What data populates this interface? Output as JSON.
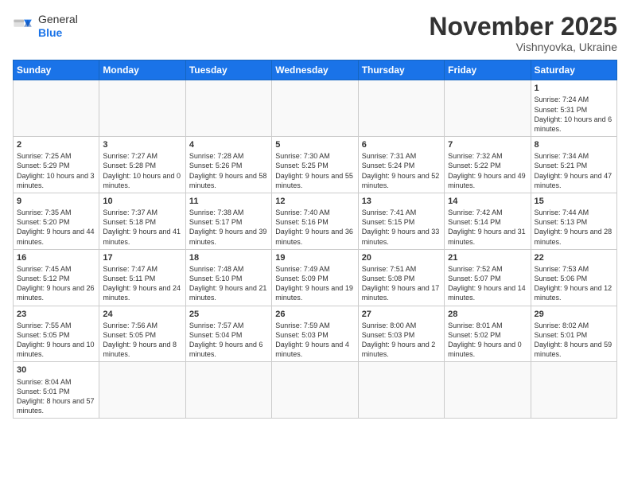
{
  "header": {
    "logo_general": "General",
    "logo_blue": "Blue",
    "month_title": "November 2025",
    "location": "Vishnyovka, Ukraine"
  },
  "weekdays": [
    "Sunday",
    "Monday",
    "Tuesday",
    "Wednesday",
    "Thursday",
    "Friday",
    "Saturday"
  ],
  "weeks": [
    [
      {
        "day": "",
        "info": ""
      },
      {
        "day": "",
        "info": ""
      },
      {
        "day": "",
        "info": ""
      },
      {
        "day": "",
        "info": ""
      },
      {
        "day": "",
        "info": ""
      },
      {
        "day": "",
        "info": ""
      },
      {
        "day": "1",
        "info": "Sunrise: 7:24 AM\nSunset: 5:31 PM\nDaylight: 10 hours and 6 minutes."
      }
    ],
    [
      {
        "day": "2",
        "info": "Sunrise: 7:25 AM\nSunset: 5:29 PM\nDaylight: 10 hours and 3 minutes."
      },
      {
        "day": "3",
        "info": "Sunrise: 7:27 AM\nSunset: 5:28 PM\nDaylight: 10 hours and 0 minutes."
      },
      {
        "day": "4",
        "info": "Sunrise: 7:28 AM\nSunset: 5:26 PM\nDaylight: 9 hours and 58 minutes."
      },
      {
        "day": "5",
        "info": "Sunrise: 7:30 AM\nSunset: 5:25 PM\nDaylight: 9 hours and 55 minutes."
      },
      {
        "day": "6",
        "info": "Sunrise: 7:31 AM\nSunset: 5:24 PM\nDaylight: 9 hours and 52 minutes."
      },
      {
        "day": "7",
        "info": "Sunrise: 7:32 AM\nSunset: 5:22 PM\nDaylight: 9 hours and 49 minutes."
      },
      {
        "day": "8",
        "info": "Sunrise: 7:34 AM\nSunset: 5:21 PM\nDaylight: 9 hours and 47 minutes."
      }
    ],
    [
      {
        "day": "9",
        "info": "Sunrise: 7:35 AM\nSunset: 5:20 PM\nDaylight: 9 hours and 44 minutes."
      },
      {
        "day": "10",
        "info": "Sunrise: 7:37 AM\nSunset: 5:18 PM\nDaylight: 9 hours and 41 minutes."
      },
      {
        "day": "11",
        "info": "Sunrise: 7:38 AM\nSunset: 5:17 PM\nDaylight: 9 hours and 39 minutes."
      },
      {
        "day": "12",
        "info": "Sunrise: 7:40 AM\nSunset: 5:16 PM\nDaylight: 9 hours and 36 minutes."
      },
      {
        "day": "13",
        "info": "Sunrise: 7:41 AM\nSunset: 5:15 PM\nDaylight: 9 hours and 33 minutes."
      },
      {
        "day": "14",
        "info": "Sunrise: 7:42 AM\nSunset: 5:14 PM\nDaylight: 9 hours and 31 minutes."
      },
      {
        "day": "15",
        "info": "Sunrise: 7:44 AM\nSunset: 5:13 PM\nDaylight: 9 hours and 28 minutes."
      }
    ],
    [
      {
        "day": "16",
        "info": "Sunrise: 7:45 AM\nSunset: 5:12 PM\nDaylight: 9 hours and 26 minutes."
      },
      {
        "day": "17",
        "info": "Sunrise: 7:47 AM\nSunset: 5:11 PM\nDaylight: 9 hours and 24 minutes."
      },
      {
        "day": "18",
        "info": "Sunrise: 7:48 AM\nSunset: 5:10 PM\nDaylight: 9 hours and 21 minutes."
      },
      {
        "day": "19",
        "info": "Sunrise: 7:49 AM\nSunset: 5:09 PM\nDaylight: 9 hours and 19 minutes."
      },
      {
        "day": "20",
        "info": "Sunrise: 7:51 AM\nSunset: 5:08 PM\nDaylight: 9 hours and 17 minutes."
      },
      {
        "day": "21",
        "info": "Sunrise: 7:52 AM\nSunset: 5:07 PM\nDaylight: 9 hours and 14 minutes."
      },
      {
        "day": "22",
        "info": "Sunrise: 7:53 AM\nSunset: 5:06 PM\nDaylight: 9 hours and 12 minutes."
      }
    ],
    [
      {
        "day": "23",
        "info": "Sunrise: 7:55 AM\nSunset: 5:05 PM\nDaylight: 9 hours and 10 minutes."
      },
      {
        "day": "24",
        "info": "Sunrise: 7:56 AM\nSunset: 5:05 PM\nDaylight: 9 hours and 8 minutes."
      },
      {
        "day": "25",
        "info": "Sunrise: 7:57 AM\nSunset: 5:04 PM\nDaylight: 9 hours and 6 minutes."
      },
      {
        "day": "26",
        "info": "Sunrise: 7:59 AM\nSunset: 5:03 PM\nDaylight: 9 hours and 4 minutes."
      },
      {
        "day": "27",
        "info": "Sunrise: 8:00 AM\nSunset: 5:03 PM\nDaylight: 9 hours and 2 minutes."
      },
      {
        "day": "28",
        "info": "Sunrise: 8:01 AM\nSunset: 5:02 PM\nDaylight: 9 hours and 0 minutes."
      },
      {
        "day": "29",
        "info": "Sunrise: 8:02 AM\nSunset: 5:01 PM\nDaylight: 8 hours and 59 minutes."
      }
    ],
    [
      {
        "day": "30",
        "info": "Sunrise: 8:04 AM\nSunset: 5:01 PM\nDaylight: 8 hours and 57 minutes."
      },
      {
        "day": "",
        "info": ""
      },
      {
        "day": "",
        "info": ""
      },
      {
        "day": "",
        "info": ""
      },
      {
        "day": "",
        "info": ""
      },
      {
        "day": "",
        "info": ""
      },
      {
        "day": "",
        "info": ""
      }
    ]
  ]
}
